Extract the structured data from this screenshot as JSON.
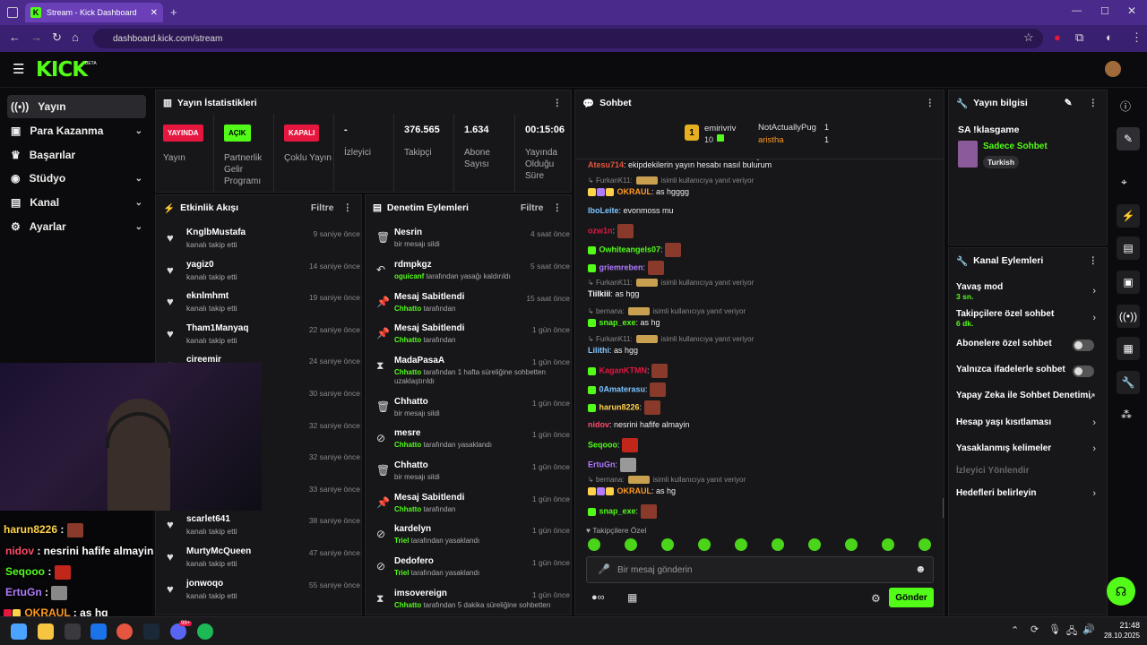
{
  "browser": {
    "tab_title": "Stream - Kick Dashboard",
    "favicon": "K",
    "url": "dashboard.kick.com/stream"
  },
  "header": {
    "logo": "KICK",
    "beta": "BETA"
  },
  "sidebar": {
    "items": [
      {
        "label": "Yayın",
        "icon": "broadcast-icon",
        "active": true
      },
      {
        "label": "Para Kazanma",
        "icon": "money-icon"
      },
      {
        "label": "Başarılar",
        "icon": "trophy-icon"
      },
      {
        "label": "Stüdyo",
        "icon": "studio-icon"
      },
      {
        "label": "Kanal",
        "icon": "channel-icon"
      },
      {
        "label": "Ayarlar",
        "icon": "settings-icon"
      }
    ]
  },
  "stats": {
    "title": "Yayın İstatistikleri",
    "items": [
      {
        "badge": "YAYINDA",
        "label": "Yayın",
        "color": "#e5173f"
      },
      {
        "badge": "AÇIK",
        "label": "Partnerlik Gelir Programı",
        "color": "#53fc18"
      },
      {
        "badge": "KAPALI",
        "label": "Çoklu Yayın",
        "color": "#e5173f"
      },
      {
        "value": "-",
        "label": "İzleyici"
      },
      {
        "value": "376.565",
        "label": "Takipçi"
      },
      {
        "value": "1.634",
        "label": "Abone Sayısı"
      },
      {
        "value": "00:15:06",
        "label": "Yayında Olduğu Süre"
      }
    ]
  },
  "activity": {
    "title": "Etkinlik Akışı",
    "filter": "Filtre",
    "rows": [
      {
        "name": "KnglbMustafa",
        "sub": "kanalı takip etti",
        "time": "9 saniye önce"
      },
      {
        "name": "yagiz0",
        "sub": "kanalı takip etti",
        "time": "14 saniye önce"
      },
      {
        "name": "eknlmhmt",
        "sub": "kanalı takip etti",
        "time": "19 saniye önce"
      },
      {
        "name": "Tham1Manyaq",
        "sub": "kanalı takip etti",
        "time": "22 saniye önce"
      },
      {
        "name": "cireemir",
        "sub": "",
        "time": "24 saniye önce"
      },
      {
        "name": "",
        "sub": "",
        "time": "30 saniye önce"
      },
      {
        "name": "",
        "sub": "",
        "time": "32 saniye önce"
      },
      {
        "name": "",
        "sub": "",
        "time": "32 saniye önce"
      },
      {
        "name": "",
        "sub": "",
        "time": "33 saniye önce"
      },
      {
        "name": "scarlet641",
        "sub": "kanalı takip etti",
        "time": "38 saniye önce"
      },
      {
        "name": "MurtyMcQueen",
        "sub": "kanalı takip etti",
        "time": "47 saniye önce"
      },
      {
        "name": "jonwoqo",
        "sub": "kanalı takip etti",
        "time": "55 saniye önce"
      }
    ]
  },
  "moderation": {
    "title": "Denetim Eylemleri",
    "filter": "Filtre",
    "rows": [
      {
        "icon": "trash-icon",
        "name": "Nesrin",
        "by": "",
        "sub": "bir mesajı sildi",
        "time": "4 saat önce"
      },
      {
        "icon": "undo-icon",
        "name": "rdmpkgz",
        "by": "oguicanf",
        "sub": " tarafından yasağı kaldırıldı",
        "time": "5 saat önce"
      },
      {
        "icon": "pin-icon",
        "name": "Mesaj Sabitlendi",
        "by": "Chhatto",
        "sub": " tarafından",
        "time": "15 saat önce"
      },
      {
        "icon": "pin-icon",
        "name": "Mesaj Sabitlendi",
        "by": "Chhatto",
        "sub": " tarafından",
        "time": "1 gün önce"
      },
      {
        "icon": "hourglass-icon",
        "name": "MadaPasaA",
        "by": "Chhatto",
        "sub": " tarafından 1 hafta süreliğine sohbetten uzaklaştırıldı",
        "time": "1 gün önce"
      },
      {
        "icon": "trash-icon",
        "name": "Chhatto",
        "by": "",
        "sub": "bir mesajı sildi",
        "time": "1 gün önce"
      },
      {
        "icon": "ban-icon",
        "name": "mesre",
        "by": "Chhatto",
        "sub": " tarafından yasaklandı",
        "time": "1 gün önce"
      },
      {
        "icon": "trash-icon",
        "name": "Chhatto",
        "by": "",
        "sub": "bir mesajı sildi",
        "time": "1 gün önce"
      },
      {
        "icon": "pin-icon",
        "name": "Mesaj Sabitlendi",
        "by": "Chhatto",
        "sub": " tarafından",
        "time": "1 gün önce"
      },
      {
        "icon": "ban-icon",
        "name": "kardelyn",
        "by": "Triel",
        "sub": " tarafından yasaklandı",
        "time": "1 gün önce"
      },
      {
        "icon": "ban-icon",
        "name": "Dedofero",
        "by": "Triel",
        "sub": " tarafından yasaklandı",
        "time": "1 gün önce"
      },
      {
        "icon": "hourglass-icon",
        "name": "imsovereign",
        "by": "Chhatto",
        "sub": " tarafından 5 dakika süreliğine sohbetten",
        "time": "1 gün önce"
      }
    ]
  },
  "chat": {
    "title": "Sohbet",
    "leader": {
      "rank": "1",
      "name": "emirivriv",
      "count": "10"
    },
    "pins": [
      {
        "name": "NotActuallyPug",
        "n": "1"
      },
      {
        "name": "aristha",
        "n": "1"
      }
    ],
    "lines": [
      {
        "user": "Atesu714",
        "color": "#e5553f",
        "text": ": ekipdekilerin yayın hesabı nasıl bulurum"
      },
      {
        "reply": "FurkanK11:",
        "replytext": "isimli kullanıcıya yanıt veriyor"
      },
      {
        "user": "OKRAUL",
        "color": "#ff9a1f",
        "text": ": as hgggg"
      },
      {
        "user": "IboLeite",
        "color": "#7cc4ff",
        "text": ": evonmoss mu"
      },
      {
        "user": "ozw1n",
        "color": "#e5173f",
        "text": ":"
      },
      {
        "user": "Owhiteangels07",
        "color": "#53fc18",
        "text": ":"
      },
      {
        "user": "griemreben",
        "color": "#b27bff",
        "text": ":"
      },
      {
        "reply": "FurkanK11:",
        "replytext": "isimli kullanıcıya yanıt veriyor"
      },
      {
        "user": "Tiilkiii",
        "color": "#ffffff",
        "text": ": as hgg"
      },
      {
        "reply": "bernana:",
        "replytext": "isimli kullanıcıya yanıt veriyor"
      },
      {
        "user": "snap_exe",
        "color": "#53fc18",
        "text": ": as hg"
      },
      {
        "reply": "FurkanK11:",
        "replytext": "isimli kullanıcıya yanıt veriyor"
      },
      {
        "user": "Lilithi",
        "color": "#7cc4ff",
        "text": ": as hgg"
      },
      {
        "user": "KaganKTMN",
        "color": "#e5173f",
        "text": ":"
      },
      {
        "user": "0Amaterasu",
        "color": "#7cc4ff",
        "text": ":"
      },
      {
        "user": "harun8226",
        "color": "#ffd24a",
        "text": ":"
      },
      {
        "user": "nidov",
        "color": "#ff4a6a",
        "text": ": nesrini hafife almayin"
      },
      {
        "user": "Seqooo",
        "color": "#53fc18",
        "text": ":"
      },
      {
        "user": "ErtuGn",
        "color": "#b27bff",
        "text": ":"
      },
      {
        "reply": "bernana:",
        "replytext": "isimli kullanıcıya yanıt veriyor"
      },
      {
        "user": "OKRAUL",
        "color": "#ff9a1f",
        "text": ": as hg"
      },
      {
        "user": "snap_exe",
        "color": "#53fc18",
        "text": ":"
      }
    ],
    "followers_only": "Takipçilere Özel",
    "placeholder": "Bir mesaj gönderin",
    "send": "Gönder"
  },
  "stream_info": {
    "title": "Yayın bilgisi",
    "stream_title": "SA !klasgame",
    "category": "Sadece Sohbet",
    "tag": "Turkish"
  },
  "channel_actions": {
    "title": "Kanal Eylemleri",
    "items": [
      {
        "label": "Yavaş mod",
        "sub": "3 sn.",
        "type": "chevron"
      },
      {
        "label": "Takipçilere özel sohbet",
        "sub": "6 dk.",
        "type": "chevron"
      },
      {
        "label": "Abonelere özel sohbet",
        "sub": "",
        "type": "toggle"
      },
      {
        "label": "Yalnızca ifadelerle sohbet",
        "sub": "",
        "type": "toggle"
      },
      {
        "label": "Yapay Zeka ile Sohbet Denetimi",
        "sub": "",
        "type": "link"
      },
      {
        "label": "Hesap yaşı kısıtlaması",
        "sub": "",
        "type": "chevron"
      },
      {
        "label": "Yasaklanmış kelimeler",
        "sub": "",
        "type": "chevron"
      },
      {
        "label": "İzleyici Yönlendir",
        "sub": "",
        "type": "disabled"
      },
      {
        "label": "Hedefleri belirleyin",
        "sub": "",
        "type": "chevron"
      }
    ]
  },
  "overlay_chat": [
    {
      "user": "harun8226",
      "color": "#ffd24a",
      "text": " :"
    },
    {
      "user": "nidov",
      "color": "#ff4a6a",
      "text": " : nesrini hafife almayin"
    },
    {
      "user": "Seqooo",
      "color": "#53fc18",
      "text": " :"
    },
    {
      "user": "ErtuGn",
      "color": "#b27bff",
      "text": " :"
    },
    {
      "user": "OKRAUL",
      "color": "#ff9a1f",
      "text": " : as hg"
    }
  ],
  "taskbar": {
    "time": "21:48",
    "date": "28.10.2025",
    "badge": "99+"
  },
  "colors": {
    "accent": "#53fc18",
    "bg": "#0b0b0d",
    "panel": "#17171a",
    "live": "#e5173f"
  }
}
